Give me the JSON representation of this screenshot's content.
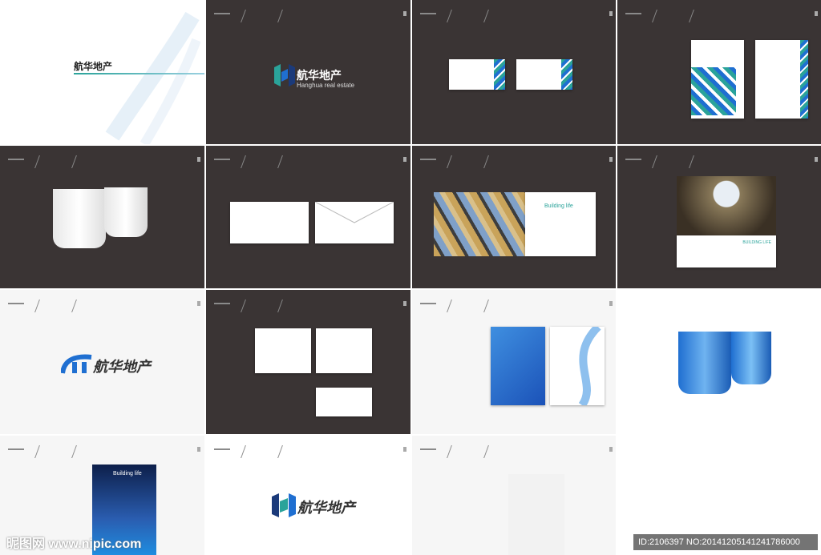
{
  "brand": {
    "name_cn": "航华地产",
    "name_en": "Hanghua real estate",
    "name_en_lower": "Hanghua realestate",
    "slogan": "Building life",
    "slogan_caps": "BUILDING LIFE"
  },
  "watermark": {
    "site": "昵图网 www.nipic.com",
    "id_text": "ID:2106397 NO:20141205141241786000"
  },
  "colors": {
    "dark_panel": "#3a3434",
    "light_panel": "#f6f6f6",
    "accent_teal": "#2aa39a",
    "accent_blue": "#1f6fd1",
    "accent_navy": "#1b3a7a"
  },
  "icons": [
    "h-monogram-logo",
    "swoosh-logo",
    "bag-handle",
    "envelope-flap",
    "cup"
  ]
}
